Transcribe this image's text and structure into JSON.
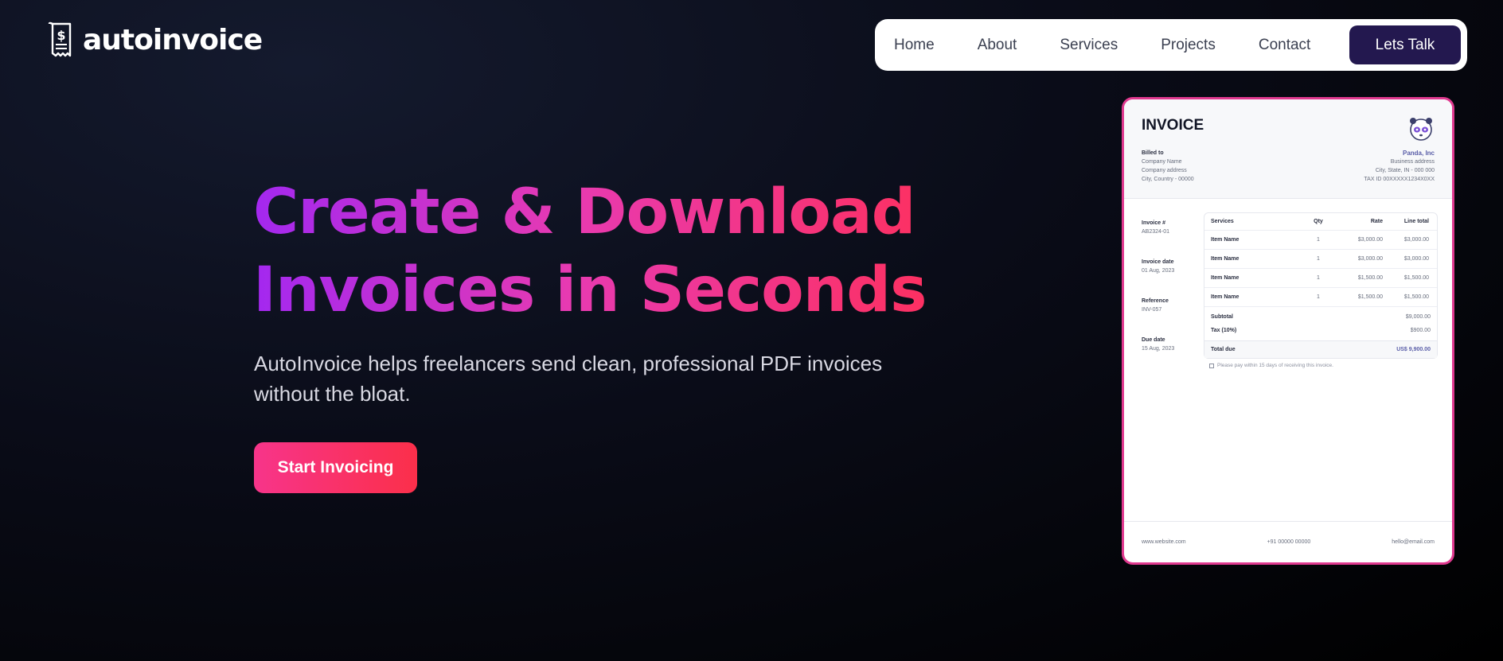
{
  "brand": {
    "name": "autoinvoice",
    "logo_icon": "receipt-dollar-icon"
  },
  "nav": {
    "links": [
      "Home",
      "About",
      "Services",
      "Projects",
      "Contact"
    ],
    "cta": "Lets Talk"
  },
  "hero": {
    "title_line1": "Create & Download",
    "title_line2": "Invoices in Seconds",
    "subtitle": "AutoInvoice helps freelancers send clean, professional PDF invoices without the bloat.",
    "cta": "Start Invoicing"
  },
  "invoice": {
    "title": "INVOICE",
    "logo_icon": "panda-icon",
    "billed_to": {
      "label": "Billed to",
      "lines": [
        "Company Name",
        "Company address",
        "City, Country - 00000"
      ]
    },
    "business": {
      "name": "Panda, Inc",
      "lines": [
        "Business address",
        "City, State, IN - 000 000",
        "TAX ID 00XXXXX1234X0XX"
      ]
    },
    "meta": [
      {
        "label": "Invoice #",
        "value": "AB2324-01"
      },
      {
        "label": "Invoice date",
        "value": "01 Aug, 2023"
      },
      {
        "label": "Reference",
        "value": "INV-057"
      },
      {
        "label": "Due date",
        "value": "15 Aug, 2023"
      }
    ],
    "columns": [
      "Services",
      "Qty",
      "Rate",
      "Line total"
    ],
    "rows": [
      {
        "name": "Item Name",
        "qty": "1",
        "rate": "$3,000.00",
        "total": "$3,000.00"
      },
      {
        "name": "Item Name",
        "qty": "1",
        "rate": "$3,000.00",
        "total": "$3,000.00"
      },
      {
        "name": "Item Name",
        "qty": "1",
        "rate": "$1,500.00",
        "total": "$1,500.00"
      },
      {
        "name": "Item Name",
        "qty": "1",
        "rate": "$1,500.00",
        "total": "$1,500.00"
      }
    ],
    "subtotal": {
      "label": "Subtotal",
      "value": "$9,000.00"
    },
    "tax": {
      "label": "Tax (10%)",
      "value": "$900.00"
    },
    "total": {
      "label": "Total due",
      "value": "US$ 9,900.00"
    },
    "note": "Please pay within 15 days of receiving this invoice.",
    "footer": {
      "website": "www.website.com",
      "phone": "+91 00000 00000",
      "email": "hello@email.com"
    }
  },
  "colors": {
    "accent_pink": "#e0398f",
    "cta_dark": "#23184f",
    "gradient_start": "#a328f0",
    "gradient_end": "#ff2f58"
  }
}
